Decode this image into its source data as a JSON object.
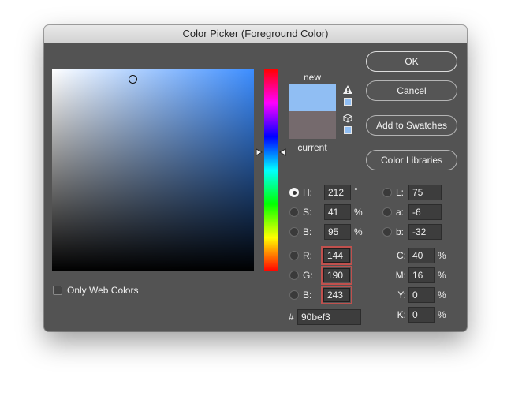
{
  "dialog": {
    "title": "Color Picker (Foreground Color)"
  },
  "swatches": {
    "new_label": "new",
    "current_label": "current",
    "new_color": "#90bef3",
    "current_color": "#756a6d",
    "warning_icon": "gamut-warning-icon",
    "cube_icon": "web-safe-cube-icon"
  },
  "buttons": {
    "ok": "OK",
    "cancel": "Cancel",
    "add_to_swatches": "Add to Swatches",
    "color_libraries": "Color Libraries"
  },
  "only_web_colors": {
    "label": "Only Web Colors",
    "checked": false
  },
  "hsb": {
    "h": {
      "label": "H:",
      "value": "212",
      "unit": "°",
      "selected": true
    },
    "s": {
      "label": "S:",
      "value": "41",
      "unit": "%",
      "selected": false
    },
    "b": {
      "label": "B:",
      "value": "95",
      "unit": "%",
      "selected": false
    }
  },
  "rgb": {
    "r": {
      "label": "R:",
      "value": "144",
      "selected": false
    },
    "g": {
      "label": "G:",
      "value": "190",
      "selected": false
    },
    "b": {
      "label": "B:",
      "value": "243",
      "selected": false
    }
  },
  "lab": {
    "l": {
      "label": "L:",
      "value": "75",
      "selected": false
    },
    "a": {
      "label": "a:",
      "value": "-6",
      "selected": false
    },
    "b": {
      "label": "b:",
      "value": "-32",
      "selected": false
    }
  },
  "cmyk": {
    "c": {
      "label": "C:",
      "value": "40",
      "unit": "%"
    },
    "m": {
      "label": "M:",
      "value": "16",
      "unit": "%"
    },
    "y": {
      "label": "Y:",
      "value": "0",
      "unit": "%"
    },
    "k": {
      "label": "K:",
      "value": "0",
      "unit": "%"
    }
  },
  "hex": {
    "label": "#",
    "value": "90bef3"
  },
  "colors": {
    "highlight": "#c0504d"
  }
}
